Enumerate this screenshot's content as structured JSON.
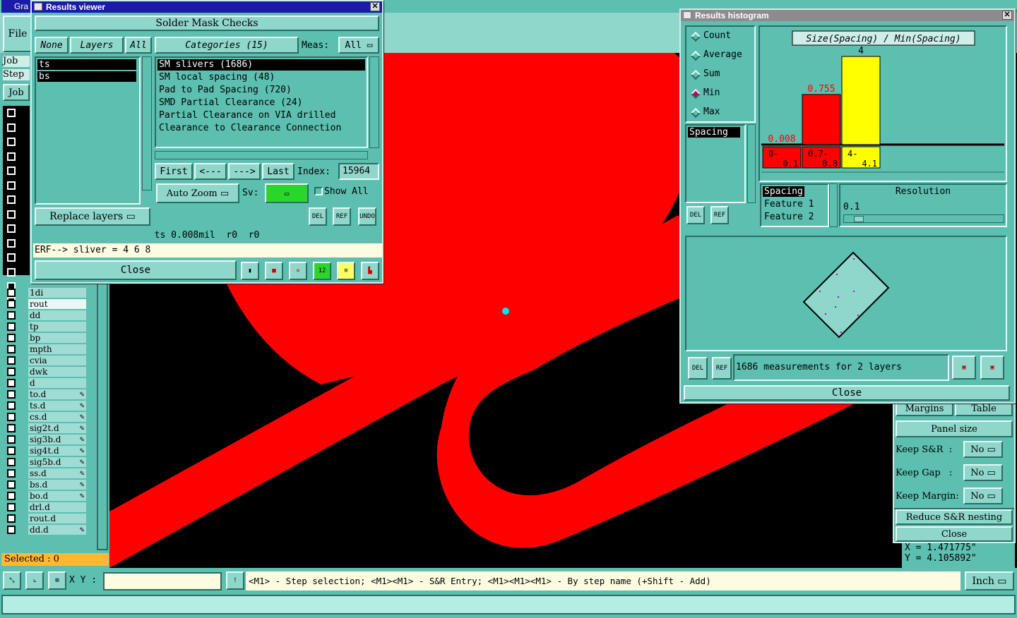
{
  "app": {
    "main_title_fragment": "Gra",
    "menu_file": "File",
    "side_job": "Job",
    "side_step": "Step",
    "side_job_btn": "Job"
  },
  "layers_list": [
    {
      "name": "1di",
      "edit": false
    },
    {
      "name": "rout",
      "edit": false
    },
    {
      "name": "dd",
      "edit": false
    },
    {
      "name": "tp",
      "edit": false
    },
    {
      "name": "bp",
      "edit": false
    },
    {
      "name": "mpth",
      "edit": false
    },
    {
      "name": "cvia",
      "edit": false
    },
    {
      "name": "dwk",
      "edit": false
    },
    {
      "name": "d",
      "edit": false
    },
    {
      "name": "to.d",
      "edit": true
    },
    {
      "name": "ts.d",
      "edit": true
    },
    {
      "name": "cs.d",
      "edit": true
    },
    {
      "name": "sig2t.d",
      "edit": true
    },
    {
      "name": "sig3b.d",
      "edit": true
    },
    {
      "name": "sig4t.d",
      "edit": true
    },
    {
      "name": "sig5b.d",
      "edit": true
    },
    {
      "name": "ss.d",
      "edit": true
    },
    {
      "name": "bs.d",
      "edit": true
    },
    {
      "name": "bo.d",
      "edit": true
    },
    {
      "name": "drl.d",
      "edit": false
    },
    {
      "name": "rout.d",
      "edit": false
    },
    {
      "name": "dd.d",
      "edit": true
    }
  ],
  "selected_label": "Selected : 0",
  "status": {
    "xy_label": "X Y :",
    "xy_value": "",
    "hint": "<M1> - Step selection; <M1><M1> - S&R Entry; <M1><M1><M1> - By step name (+Shift - Add)",
    "units": "Inch"
  },
  "coords": {
    "x": "X = 1.471775\"",
    "y": "Y = 4.105892\""
  },
  "results_viewer": {
    "title": "Results viewer",
    "header": "Solder Mask Checks",
    "none_btn": "None",
    "layers_btn": "Layers",
    "all_btn": "All",
    "categories_btn": "Categories (15)",
    "meas_label": "Meas:",
    "meas_value": "All",
    "layers": [
      "ts",
      "bs"
    ],
    "categories": [
      "SM slivers (1686)",
      "SM local spacing (48)",
      "Pad to Pad Spacing (720)",
      "SMD Partial Clearance (24)",
      "Partial Clearance on VIA drilled",
      "Clearance to Clearance Connection"
    ],
    "first_btn": "First",
    "prev_btn": "<---",
    "next_btn": "--->",
    "last_btn": "Last",
    "index_label": "Index:",
    "index_value": "15964",
    "replace_btn": "Replace layers",
    "autozoom_btn": "Auto Zoom",
    "sv_label": "Sv:",
    "show_all_label": "Show All",
    "del_label": "DEL",
    "ref_label": "REF",
    "undo_label": "UNDO",
    "info_line": "ts 0.008mil  r0  r0",
    "erf_line": "ERF--> sliver = 4 6 8",
    "close_btn": "Close"
  },
  "histogram": {
    "title": "Results histogram",
    "modes": [
      {
        "label": "Count",
        "selected": false
      },
      {
        "label": "Average",
        "selected": false
      },
      {
        "label": "Sum",
        "selected": false
      },
      {
        "label": "Min",
        "selected": true
      },
      {
        "label": "Max",
        "selected": false
      }
    ],
    "measure_list_item": "Spacing",
    "del_label": "DEL",
    "ref_label": "REF",
    "resolution_label": "Resolution",
    "resolution_value": "0.1",
    "feature_list": [
      "Spacing",
      "Feature 1",
      "Feature 2"
    ],
    "summary": "1686 measurements for 2 layers",
    "close_btn": "Close"
  },
  "chart_data": {
    "type": "bar",
    "title": "Size(Spacing) / Min(Spacing)",
    "categories": [
      "0-0.1",
      "0.7-0.8",
      "4-4.1"
    ],
    "category_top": [
      "0-",
      "0.7-",
      "4-"
    ],
    "category_bottom": [
      "0.1",
      "0.8",
      "4.1"
    ],
    "values": [
      0.008,
      0.755,
      4
    ],
    "value_labels": [
      "0.008",
      "0.755",
      "4"
    ],
    "colors": [
      "#ff0000",
      "#ff0000",
      "#ffff00"
    ],
    "label_colors": [
      "#ff0000",
      "#ff0000",
      "#000000"
    ],
    "ylim": [
      0,
      4
    ],
    "grid": false
  },
  "right_panel": {
    "margins_btn": "Margins",
    "table_btn": "Table",
    "panel_size_btn": "Panel size",
    "keep_sr_label": "Keep S&R  :",
    "keep_sr_value": "No",
    "keep_gap_label": "Keep Gap   :",
    "keep_gap_value": "No",
    "keep_margin_label": "Keep Margin:",
    "keep_margin_value": "No",
    "reduce_btn": "Reduce S&R nesting",
    "close_btn": "Close"
  },
  "colors": {
    "copper": "#ff0000",
    "panel": "#5cbfb0",
    "title": "#1b1ba8",
    "marker": "#00e5ee"
  }
}
